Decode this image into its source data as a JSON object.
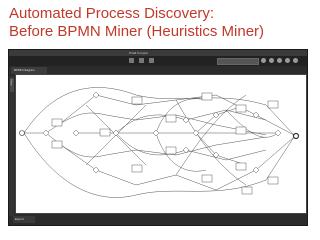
{
  "slide": {
    "title_line1": "Automated Process Discovery:",
    "title_line2": "Before BPMN Miner (Heuristics Miner)"
  },
  "window": {
    "title": "ProM 6 Import"
  },
  "tab": {
    "label": "BPMN Diagram"
  },
  "sidebar": {
    "label": "View"
  },
  "bottom_panel": {
    "label": "Export"
  },
  "colors": {
    "title": "#c0392b",
    "window_bg": "#2b2b2b",
    "canvas": "#ffffff",
    "edges": "#555555"
  },
  "toolbar": {
    "icons": [
      "grid-icon",
      "zoom-icon",
      "settings-icon",
      "export-icon"
    ]
  }
}
